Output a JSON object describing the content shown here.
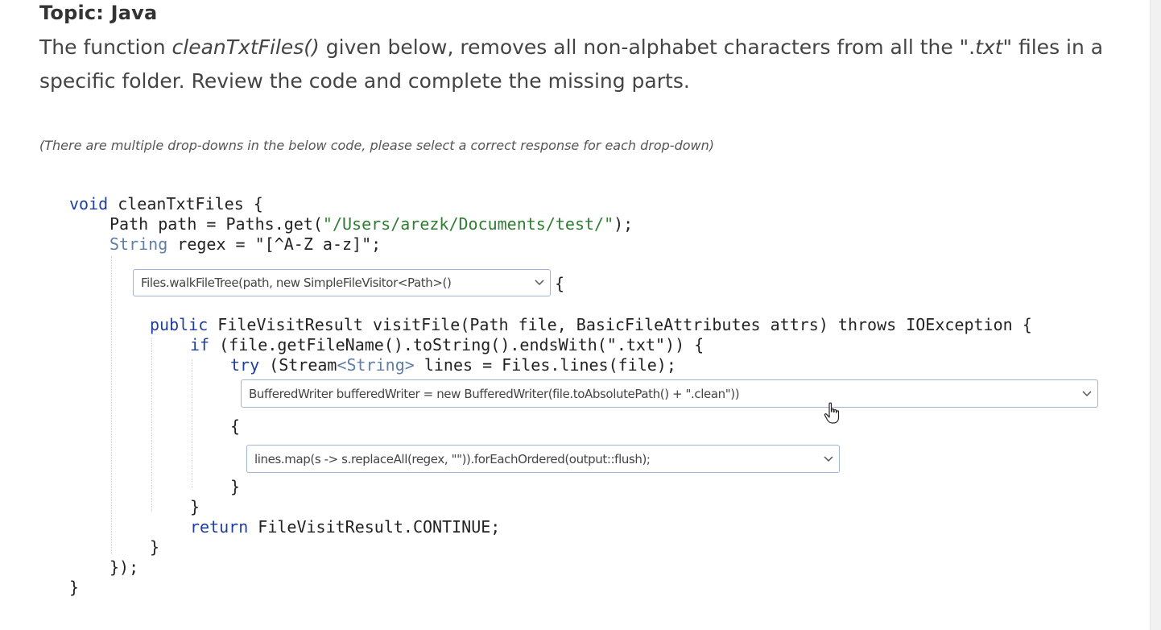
{
  "topic": "Topic: Java",
  "question": {
    "part1": "The function ",
    "function_name": "cleanTxtFiles()",
    "part2": " given below, removes all non-alphabet characters from all the \".",
    "ext": "txt",
    "part3": "\" files in a specific folder. Review the code and complete the missing parts."
  },
  "hint": "(There are multiple drop-downs in the below code, please select a correct response for each drop-down)",
  "code": {
    "l1_kw": "void",
    "l1_rest": " cleanTxtFiles {",
    "l2_a": "Path path = Paths.get(",
    "l2_str": "\"/Users/arezk/Documents/test/\"",
    "l2_b": ");",
    "l3_ty": "String",
    "l3_rest": " regex = \"[^A-Z a-z]\";",
    "l4_brace": "{",
    "l5_kw": "public",
    "l5_rest": " FileVisitResult visitFile(Path file, BasicFileAttributes attrs) throws IOException {",
    "l6_kw": "if",
    "l6_rest": " (file.getFileName().toString().endsWith(\".txt\")) {",
    "l7_kw": "try",
    "l7_a": " (Stream",
    "l7_ty": "<String>",
    "l7_b": " lines = Files.lines(file);",
    "l8_brace": "{",
    "l9_close": "}",
    "l10_close": "}",
    "l11_kw": "return",
    "l11_rest": " FileVisitResult.CONTINUE;",
    "l12_close": "}",
    "l13_close": "});",
    "l14_close": "}"
  },
  "dropdowns": {
    "walk": "Files.walkFileTree(path, new SimpleFileVisitor<Path>()",
    "writer": "BufferedWriter bufferedWriter = new BufferedWriter(file.toAbsolutePath() + \".clean\"))",
    "map": "lines.map(s -> s.replaceAll(regex, \"\")).forEachOrdered(output::flush);"
  }
}
